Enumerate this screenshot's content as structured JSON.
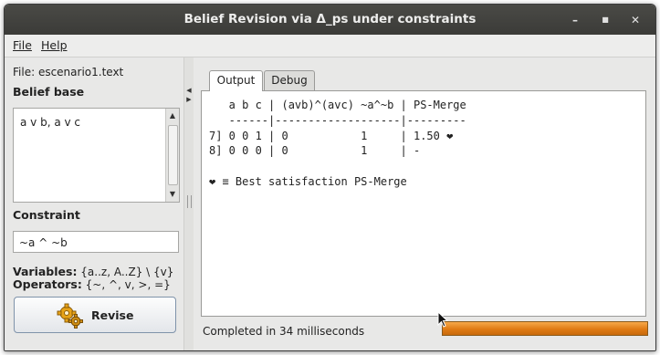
{
  "window": {
    "title": "Belief Revision via Δ_ps under constraints",
    "minimize_glyph": "–",
    "maximize_glyph": "■",
    "close_glyph": "✕"
  },
  "menu": {
    "file": "File",
    "help": "Help"
  },
  "left": {
    "file_label": "File: escenario1.text",
    "belief_base_heading": "Belief base",
    "belief_base_value": "a v b, a v c",
    "constraint_heading": "Constraint",
    "constraint_value": "~a ^ ~b",
    "variables_label": "Variables:",
    "variables_value": "{a..z, A..Z} \\ {v}",
    "operators_label": "Operators:",
    "operators_value": "{~, ^, v, >, =}",
    "revise_label": "Revise",
    "revise_icon": "gears-icon"
  },
  "tabs": {
    "output": "Output",
    "debug": "Debug"
  },
  "output": {
    "lines": [
      "   a b c | (avb)^(avc) ~a^~b | PS-Merge",
      "   ------|-------------------|---------",
      "7] 0 0 1 | 0           1     | 1.50 ❤",
      "8] 0 0 0 | 0           1     | -",
      "",
      "❤ ≡ Best satisfaction PS-Merge"
    ]
  },
  "status": {
    "text": "Completed in 34 milliseconds",
    "progress": 1.0,
    "progress_color": "#e07b14"
  }
}
